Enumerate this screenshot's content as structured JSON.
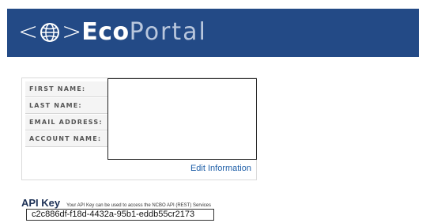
{
  "header": {
    "brand_left": "<",
    "brand_right": ">",
    "brand_bold": "Eco",
    "brand_light": "Portal",
    "bg_color": "#234a86"
  },
  "account": {
    "fields": [
      {
        "label": "FIRST NAME:",
        "value": ""
      },
      {
        "label": "LAST NAME:",
        "value": ""
      },
      {
        "label": "EMAIL ADDRESS:",
        "value": ""
      },
      {
        "label": "ACCOUNT NAME:",
        "value": ""
      }
    ],
    "edit_link": "Edit Information"
  },
  "api": {
    "heading": "API Key",
    "description": "Your API Key can be used to access the NCBO API (REST) Services",
    "key": "c2c886df-f18d-4432a-95b1-eddb55cr2173"
  }
}
